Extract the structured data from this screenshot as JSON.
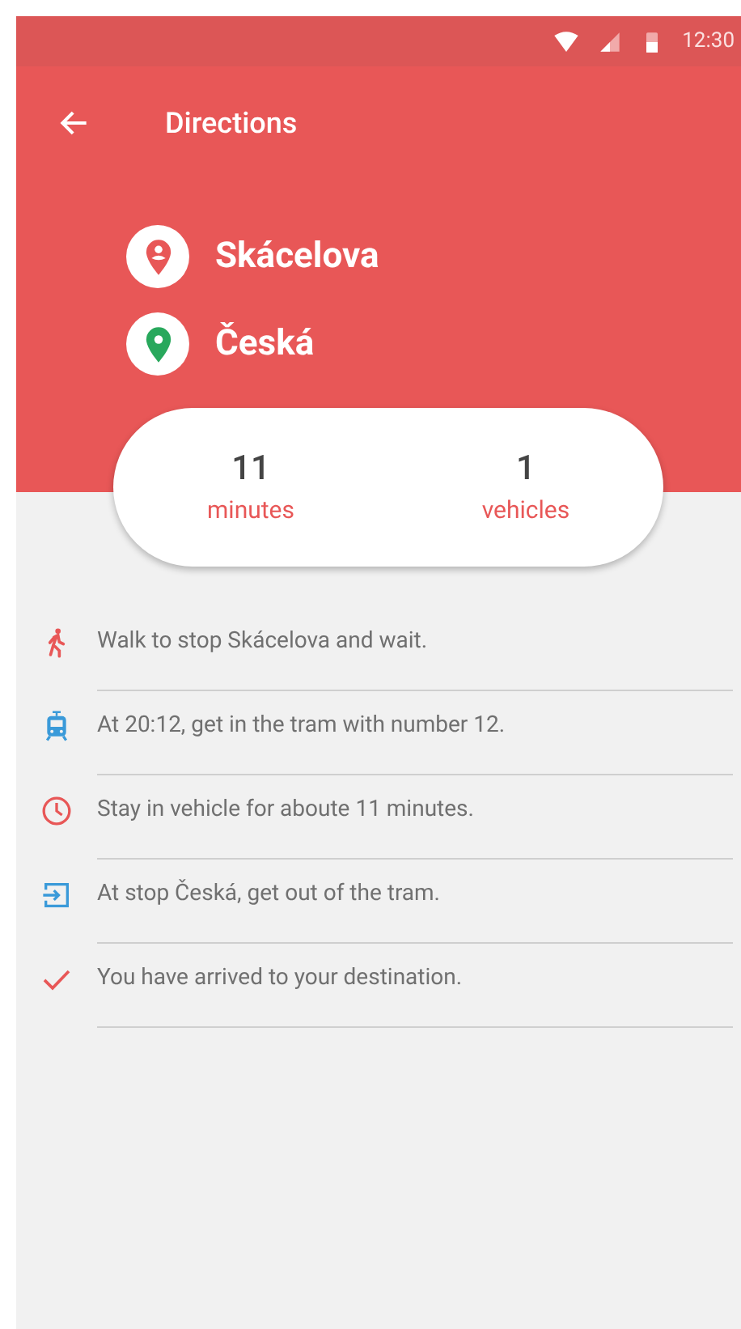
{
  "status_bar": {
    "time": "12:30"
  },
  "app_bar": {
    "title": "Directions"
  },
  "route": {
    "from": "Skácelova",
    "to": "Česká"
  },
  "summary": [
    {
      "value": "11",
      "label": "minutes"
    },
    {
      "value": "1",
      "label": "vehicles"
    }
  ],
  "steps": [
    {
      "kind": "walk",
      "color": "#e85757",
      "text": "Walk to stop Skácelova and wait."
    },
    {
      "kind": "tram",
      "color": "#3a9ad9",
      "text": "At 20:12, get in the tram with number 12."
    },
    {
      "kind": "clock",
      "color": "#e85757",
      "text": "Stay in vehicle for aboute 11 minutes."
    },
    {
      "kind": "exit",
      "color": "#3a9ad9",
      "text": "At stop Česká, get out of the tram."
    },
    {
      "kind": "check",
      "color": "#e85757",
      "text": "You have arrived to your destination."
    }
  ]
}
